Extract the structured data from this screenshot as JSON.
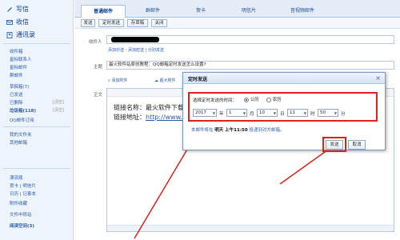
{
  "sidebar": {
    "write": "写信",
    "inbox": "收信",
    "contacts": "通讯录",
    "items": [
      {
        "label": "收件箱"
      },
      {
        "label": "星标联系人"
      },
      {
        "label": "星标邮件"
      },
      {
        "label": "群邮件"
      },
      {
        "label": "草稿箱(7)"
      },
      {
        "label": "已发送"
      },
      {
        "label": "已删除",
        "count": "[清空]"
      },
      {
        "label": "垃圾箱(118)",
        "count": "[清空]"
      },
      {
        "label": "QQ邮件订阅"
      },
      {
        "label": "我的文件夹"
      },
      {
        "label": "其他邮箱"
      },
      {
        "label": "漂流瓶"
      },
      {
        "label": "贺卡 | 明信片"
      },
      {
        "label": "日历 | 记事本"
      },
      {
        "label": "附件收藏"
      },
      {
        "label": "文件中转站"
      },
      {
        "label": "阅读空间(3)"
      }
    ]
  },
  "tabs": [
    "普通邮件",
    "群邮件",
    "贺卡",
    "明信片",
    "音视频邮件"
  ],
  "toolbar": {
    "send": "发送",
    "scheduled": "定时发送",
    "draft": "存草稿",
    "close": "关闭"
  },
  "compose": {
    "to_label": "收件人",
    "to_links": "添加抄送 - 添加密送 | 分别发送",
    "subject_label": "主题",
    "subject_value": "最火软件站原创教程：QQ邮箱定时发送怎么设置?",
    "attach": "添加附件",
    "big_attach": "超大附件",
    "body_label": "正文",
    "body_line1": "链接名称：最火软件下载",
    "body_line2_prefix": "链接地址：",
    "body_line2_link": "http://www.ve"
  },
  "modal": {
    "title": "定时发送",
    "close_icon": "×",
    "select_label": "选择定时发送的时间：",
    "gregorian": "公历",
    "lunar": "农历",
    "year": "2017",
    "year_unit": "年",
    "month": "1",
    "month_unit": "月",
    "day": "10",
    "day_unit": "日",
    "hour": "11",
    "hour_unit": "时",
    "minute": "50",
    "minute_unit": "分",
    "note_prefix": "本邮件将在",
    "note_time": "明天 上午11:50",
    "note_suffix": "投递到对方邮箱。",
    "send": "发送",
    "cancel": "取消"
  },
  "colors": {
    "accent": "#e0201a",
    "link": "#2a5aa8",
    "panel": "#eef4fb"
  }
}
